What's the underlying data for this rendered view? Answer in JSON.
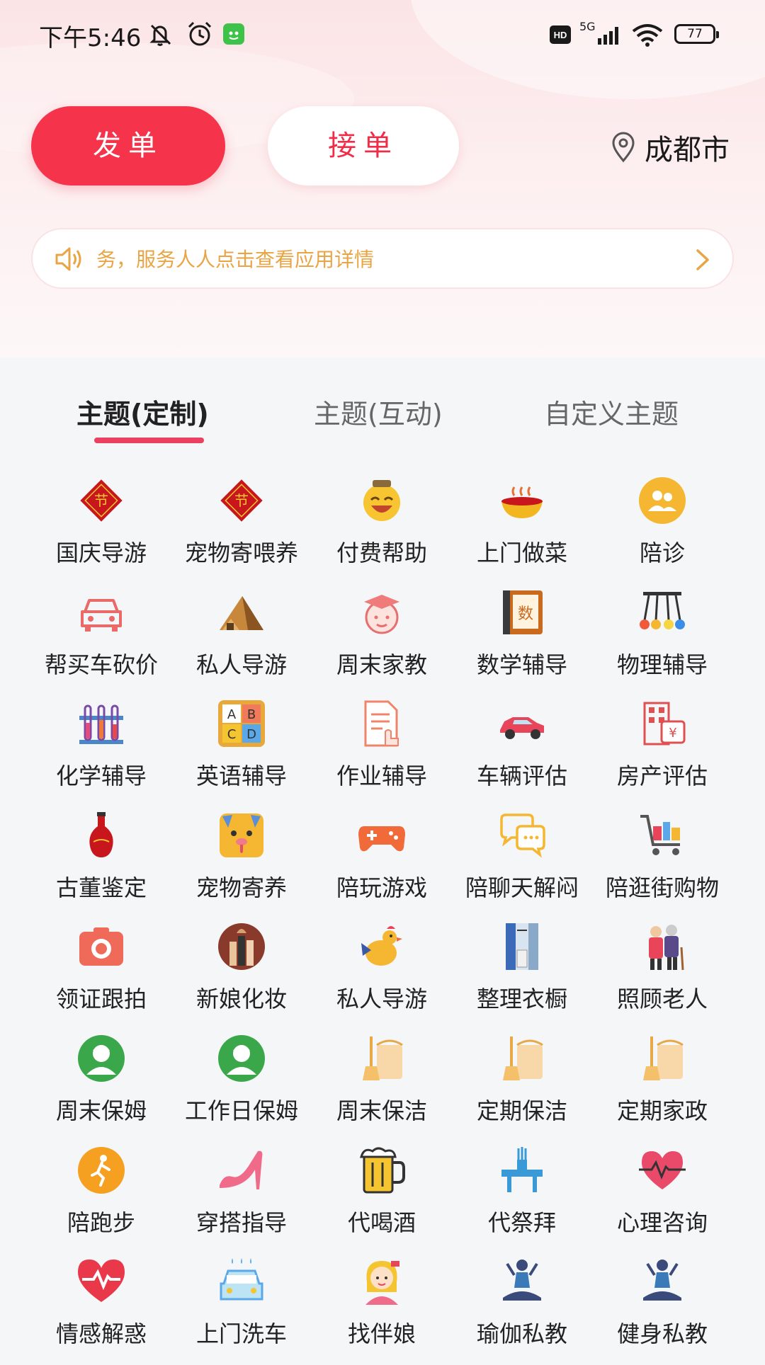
{
  "status_bar": {
    "time": "下午5:46",
    "battery": "77",
    "network": "5G",
    "hd": "HD",
    "icons": [
      "mute-icon",
      "alarm-icon",
      "app-notification-icon",
      "hd-icon",
      "signal-icon",
      "wifi-icon",
      "battery-icon"
    ]
  },
  "header": {
    "publish_label": "发单",
    "accept_label": "接单",
    "city": "成都市"
  },
  "notice": {
    "text": "务，服务人人点击查看应用详情"
  },
  "tabs": [
    {
      "label": "主题(定制)",
      "active": true
    },
    {
      "label": "主题(互动)",
      "active": false
    },
    {
      "label": "自定义主题",
      "active": false
    }
  ],
  "colors": {
    "accent": "#f5334a",
    "notice_text": "#e9a545",
    "tab_indicator": "#ec4060"
  },
  "services": [
    {
      "label": "国庆导游",
      "icon": "festival-icon"
    },
    {
      "label": "宠物寄喂养",
      "icon": "festival-icon"
    },
    {
      "label": "付费帮助",
      "icon": "laughing-face-icon"
    },
    {
      "label": "上门做菜",
      "icon": "cooking-bowl-icon"
    },
    {
      "label": "陪诊",
      "icon": "people-icon"
    },
    {
      "label": "帮买车砍价",
      "icon": "car-front-icon"
    },
    {
      "label": "私人导游",
      "icon": "pyramid-icon"
    },
    {
      "label": "周末家教",
      "icon": "graduate-icon"
    },
    {
      "label": "数学辅导",
      "icon": "math-book-icon"
    },
    {
      "label": "物理辅导",
      "icon": "pendulum-icon"
    },
    {
      "label": "化学辅导",
      "icon": "test-tubes-icon"
    },
    {
      "label": "英语辅导",
      "icon": "abcd-blocks-icon"
    },
    {
      "label": "作业辅导",
      "icon": "homework-doc-icon"
    },
    {
      "label": "车辆评估",
      "icon": "car-side-icon"
    },
    {
      "label": "房产评估",
      "icon": "building-price-icon"
    },
    {
      "label": "古董鉴定",
      "icon": "vase-icon"
    },
    {
      "label": "宠物寄养",
      "icon": "pet-face-icon"
    },
    {
      "label": "陪玩游戏",
      "icon": "gamepad-icon"
    },
    {
      "label": "陪聊天解闷",
      "icon": "chat-bubbles-icon"
    },
    {
      "label": "陪逛街购物",
      "icon": "shopping-cart-icon"
    },
    {
      "label": "领证跟拍",
      "icon": "camera-icon"
    },
    {
      "label": "新娘化妆",
      "icon": "makeup-brush-icon"
    },
    {
      "label": "私人导游",
      "icon": "rooster-icon"
    },
    {
      "label": "整理衣橱",
      "icon": "wardrobe-icon"
    },
    {
      "label": "照顾老人",
      "icon": "elderly-icon"
    },
    {
      "label": "周末保姆",
      "icon": "nanny-icon"
    },
    {
      "label": "工作日保姆",
      "icon": "nanny-icon"
    },
    {
      "label": "周末保洁",
      "icon": "broom-bucket-icon"
    },
    {
      "label": "定期保洁",
      "icon": "broom-bucket-icon"
    },
    {
      "label": "定期家政",
      "icon": "broom-bucket-icon"
    },
    {
      "label": "陪跑步",
      "icon": "runner-icon"
    },
    {
      "label": "穿搭指导",
      "icon": "high-heel-icon"
    },
    {
      "label": "代喝酒",
      "icon": "beer-mug-icon"
    },
    {
      "label": "代祭拜",
      "icon": "altar-icon"
    },
    {
      "label": "心理咨询",
      "icon": "heart-pulse-icon"
    },
    {
      "label": "情感解惑",
      "icon": "heart-pulse-red-icon"
    },
    {
      "label": "上门洗车",
      "icon": "car-wash-icon"
    },
    {
      "label": "找伴娘",
      "icon": "bridesmaid-icon"
    },
    {
      "label": "瑜伽私教",
      "icon": "yoga-icon"
    },
    {
      "label": "健身私教",
      "icon": "yoga-icon"
    }
  ]
}
